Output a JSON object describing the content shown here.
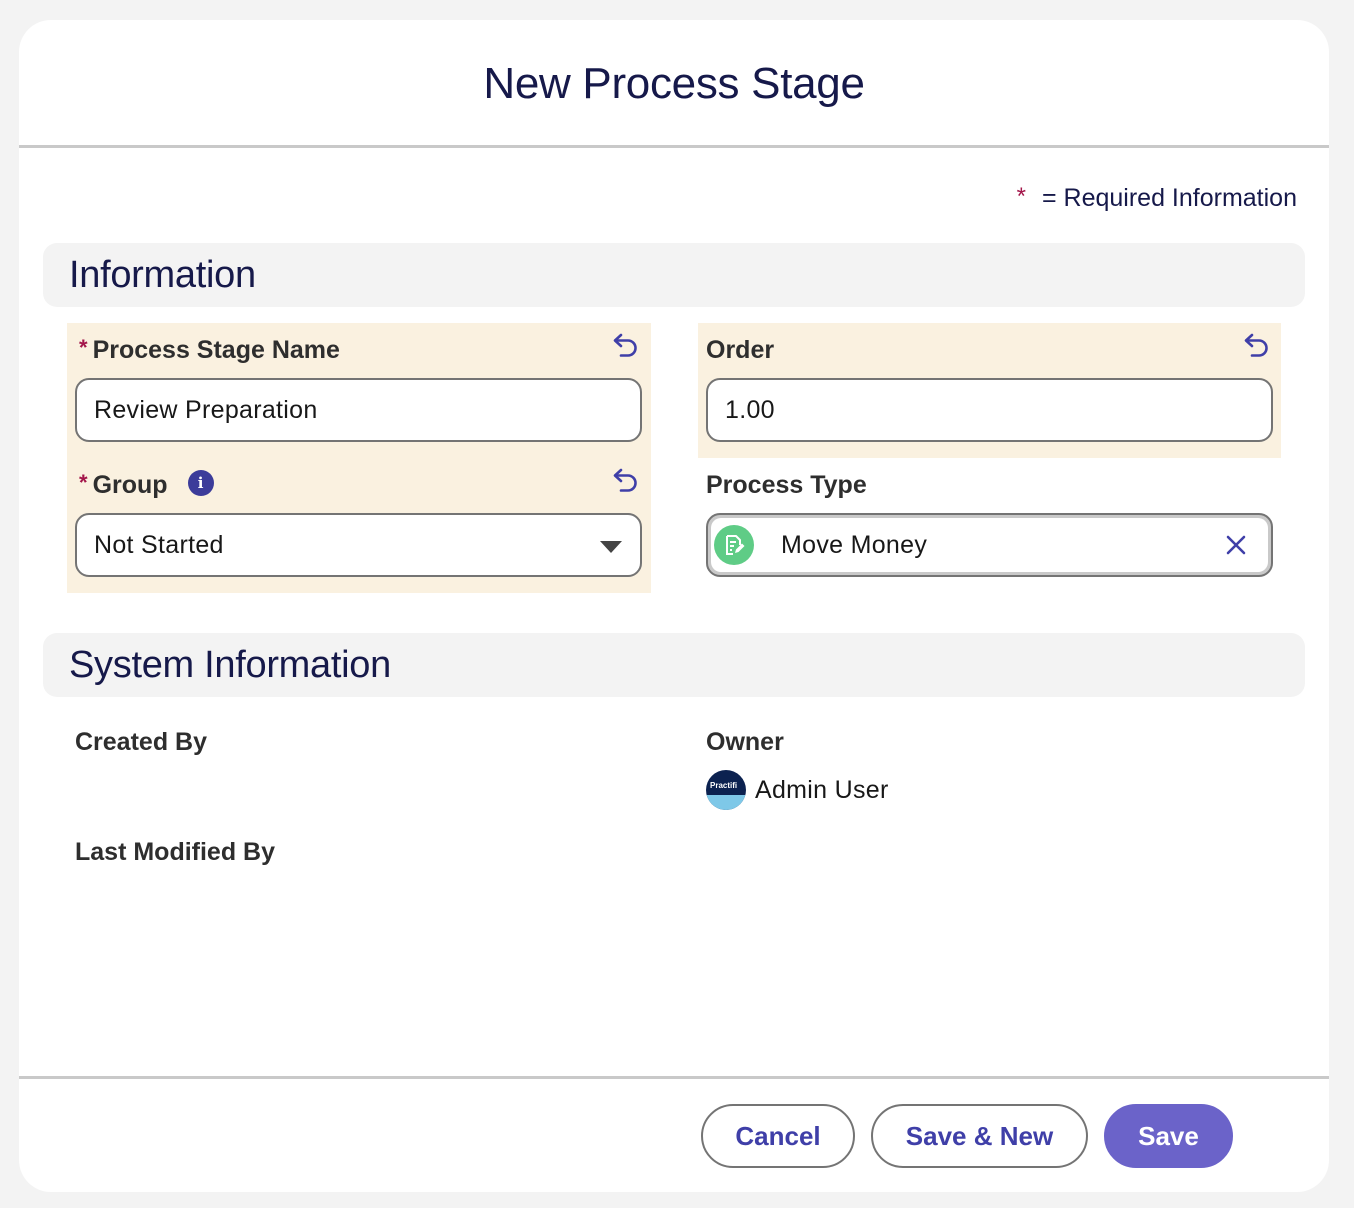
{
  "modal": {
    "title": "New Process Stage",
    "required_note": {
      "star": "*",
      "text": "= Required Information"
    }
  },
  "sections": {
    "information": "Information",
    "system_information": "System Information"
  },
  "fields": {
    "process_stage_name": {
      "required_marker": "*",
      "label": "Process Stage Name",
      "value": "Review Preparation",
      "edited": true
    },
    "order": {
      "label": "Order",
      "value": "1.00",
      "edited": true
    },
    "group": {
      "required_marker": "*",
      "label": "Group",
      "info_icon_text": "i",
      "value": "Not Started",
      "edited": true
    },
    "process_type": {
      "label": "Process Type",
      "value": "Move Money",
      "icon": "process-type-icon"
    }
  },
  "system": {
    "created_by_label": "Created By",
    "owner_label": "Owner",
    "owner_avatar_text": "Practifi",
    "owner_value": "Admin User",
    "last_modified_by_label": "Last Modified By"
  },
  "footer": {
    "cancel": "Cancel",
    "save_new": "Save & New",
    "save": "Save"
  },
  "colors": {
    "brand": "#6b63c9",
    "title": "#16194a",
    "edited_bg": "#faf1e0",
    "required": "#a3164a",
    "lookup_icon": "#5fcc86"
  }
}
